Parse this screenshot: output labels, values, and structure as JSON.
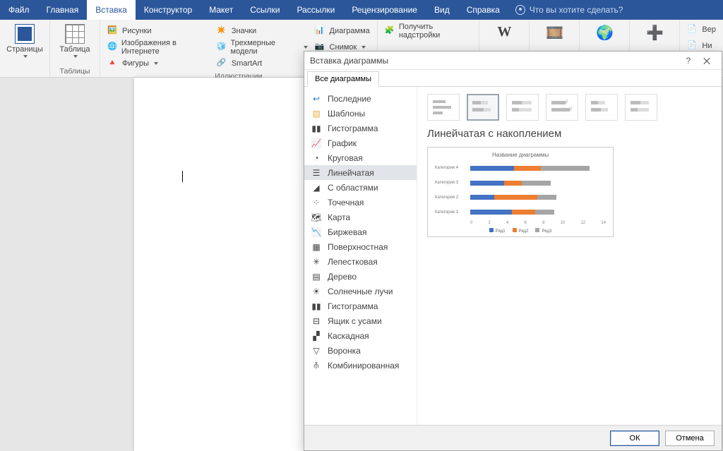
{
  "menubar": {
    "tabs": [
      "Файл",
      "Главная",
      "Вставка",
      "Конструктор",
      "Макет",
      "Ссылки",
      "Рассылки",
      "Рецензирование",
      "Вид",
      "Справка"
    ],
    "active_index": 2,
    "tell_me": "Что вы хотите сделать?"
  },
  "ribbon": {
    "pages_btn": "Страницы",
    "tables_btn": "Таблица",
    "tables_group": "Таблицы",
    "ill": {
      "pictures": "Рисунки",
      "online_pics": "Изображения в Интернете",
      "shapes": "Фигуры",
      "icons": "Значки",
      "models3d": "Трехмерные модели",
      "smartart": "SmartArt",
      "chart": "Диаграмма",
      "screenshot": "Снимок",
      "group": "Иллюстрации"
    },
    "addins": {
      "get": "Получить надстройки"
    },
    "right1": "Вер",
    "right2": "Ни"
  },
  "dialog": {
    "title": "Вставка диаграммы",
    "tab": "Все диаграммы",
    "categories": [
      "Последние",
      "Шаблоны",
      "Гистограмма",
      "График",
      "Круговая",
      "Линейчатая",
      "С областями",
      "Точечная",
      "Карта",
      "Биржевая",
      "Поверхностная",
      "Лепестковая",
      "Дерево",
      "Солнечные лучи",
      "Гистограмма",
      "Ящик с усами",
      "Каскадная",
      "Воронка",
      "Комбинированная"
    ],
    "selected_category_index": 5,
    "chart_heading": "Линейчатая с накоплением",
    "ok": "ОК",
    "cancel": "Отмена"
  },
  "chart_data": {
    "type": "bar",
    "title": "Название диаграммы",
    "orientation": "horizontal",
    "stacked": true,
    "categories": [
      "Категория 4",
      "Категория 3",
      "Категория 2",
      "Категория 1"
    ],
    "series": [
      {
        "name": "Ряд1",
        "color": "#4472c4",
        "values": [
          4.5,
          3.5,
          2.5,
          4.3
        ]
      },
      {
        "name": "Ряд2",
        "color": "#ed7d31",
        "values": [
          2.8,
          1.8,
          4.4,
          2.4
        ]
      },
      {
        "name": "Ряд3",
        "color": "#a5a5a5",
        "values": [
          5.0,
          3.0,
          2.0,
          2.0
        ]
      }
    ],
    "x_ticks": [
      0,
      2,
      4,
      6,
      8,
      10,
      12,
      14
    ],
    "xlim": [
      0,
      14
    ],
    "legend_labels": [
      "Ряд1",
      "Ряд2",
      "Ряд3"
    ]
  }
}
